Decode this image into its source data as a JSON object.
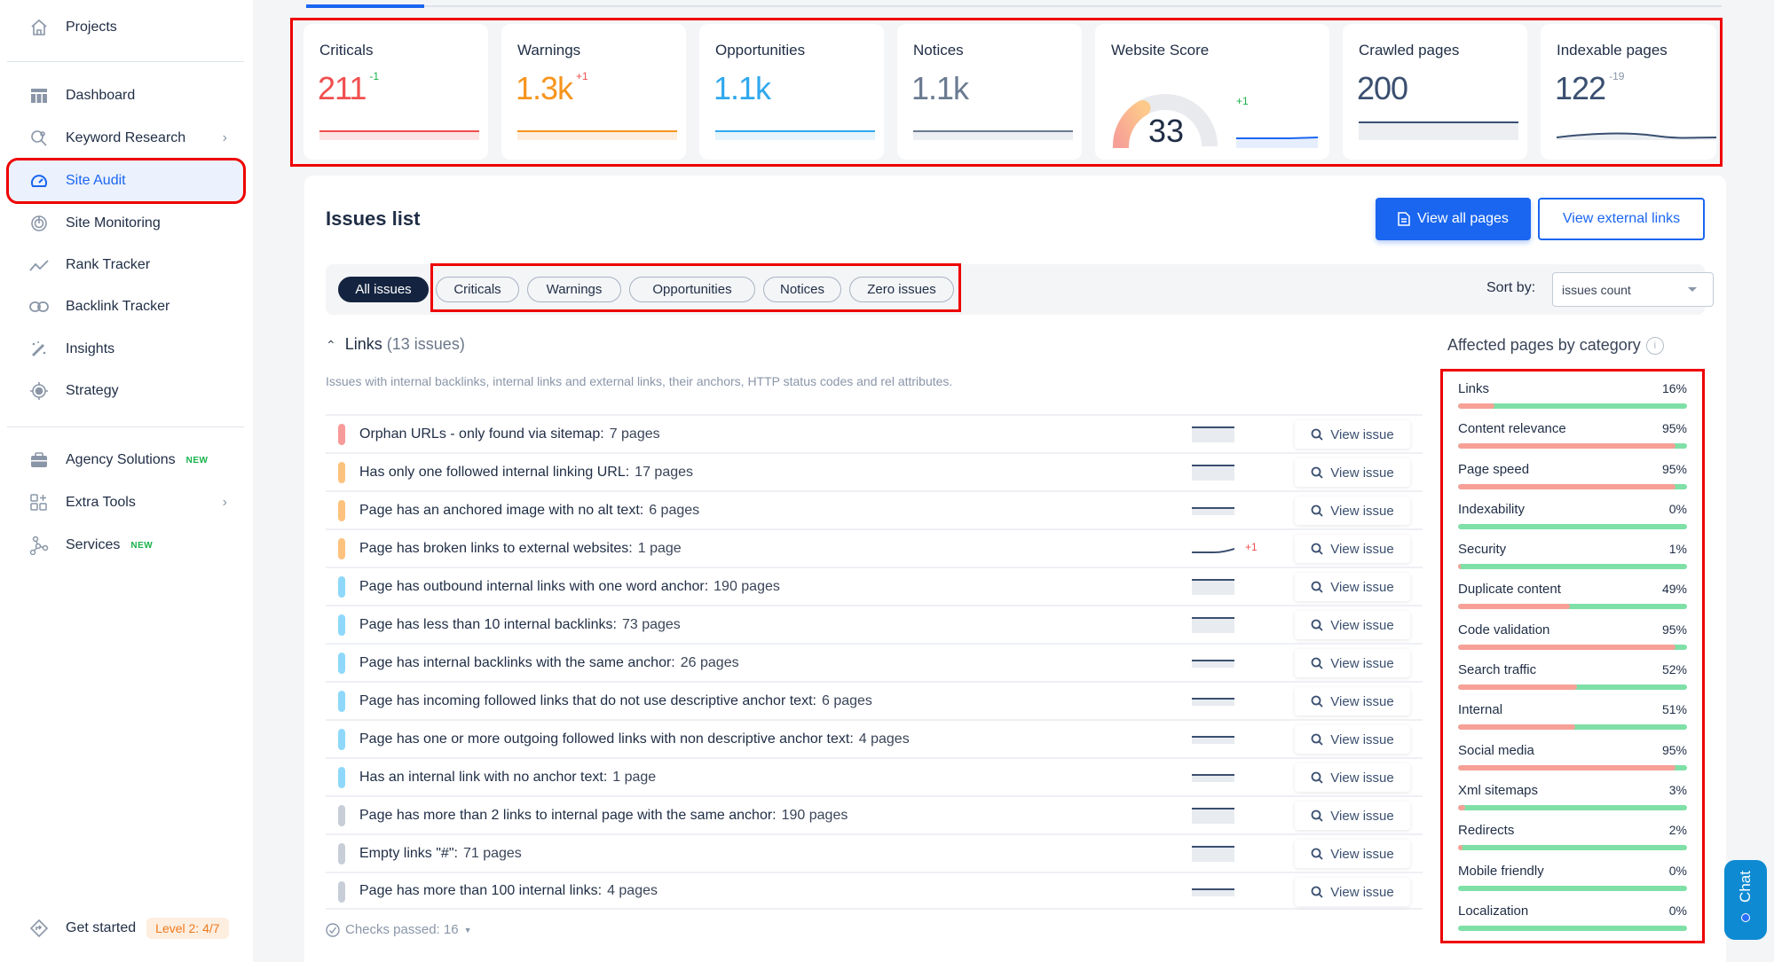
{
  "sidebar": {
    "items": [
      {
        "label": "Projects",
        "icon": "home-icon"
      },
      {
        "label": "Dashboard",
        "icon": "dashboard-icon"
      },
      {
        "label": "Keyword Research",
        "icon": "keyword-research-icon",
        "chevron": true
      },
      {
        "label": "Site Audit",
        "icon": "gauge-icon",
        "active": true
      },
      {
        "label": "Site Monitoring",
        "icon": "monitoring-icon"
      },
      {
        "label": "Rank Tracker",
        "icon": "trend-icon"
      },
      {
        "label": "Backlink Tracker",
        "icon": "link-icon"
      },
      {
        "label": "Insights",
        "icon": "magic-wand-icon"
      },
      {
        "label": "Strategy",
        "icon": "target-icon"
      },
      {
        "label": "Agency Solutions",
        "icon": "briefcase-icon",
        "badge": "NEW"
      },
      {
        "label": "Extra Tools",
        "icon": "grid-plus-icon",
        "chevron": true
      },
      {
        "label": "Services",
        "icon": "nodes-icon",
        "badge": "NEW"
      }
    ],
    "get_started": {
      "label": "Get started",
      "level": "Level 2: 4/7"
    }
  },
  "cards": [
    {
      "title": "Criticals",
      "value": "211",
      "delta": "-1",
      "color": "#f04f4f",
      "delta_color": "#17b24a"
    },
    {
      "title": "Warnings",
      "value": "1.3k",
      "delta": "+1",
      "color": "#f7941d",
      "delta_color": "#f04f4f"
    },
    {
      "title": "Opportunities",
      "value": "1.1k",
      "delta": "",
      "color": "#2fa8ee"
    },
    {
      "title": "Notices",
      "value": "1.1k",
      "delta": "",
      "color": "#6b7a90"
    },
    {
      "title": "Website Score",
      "value": "33",
      "delta": "+1",
      "score_percent": 33,
      "delta_color": "#17b24a"
    },
    {
      "title": "Crawled pages",
      "value": "200",
      "delta": "",
      "color": "#3a4f70"
    },
    {
      "title": "Indexable pages",
      "value": "122",
      "delta": "-19",
      "color": "#3a4f70",
      "delta_color": "#8a96a8"
    }
  ],
  "issues": {
    "title": "Issues list",
    "view_all_pages": "View all pages",
    "view_external_links": "View external links",
    "filters": [
      "All issues",
      "Criticals",
      "Warnings",
      "Opportunities",
      "Notices",
      "Zero issues"
    ],
    "active_filter": "All issues",
    "sort_label": "Sort by:",
    "sort_value": "issues count",
    "group": {
      "name": "Links",
      "count": "(13 issues)",
      "description": "Issues with internal backlinks, internal links and external links, their anchors, HTTP status codes and rel attributes."
    },
    "view_issue_label": "View issue",
    "rows": [
      {
        "text": "Orphan URLs - only found via sitemap:",
        "pages": "7 pages",
        "severity": "critical",
        "delta": ""
      },
      {
        "text": "Has only one followed internal linking URL:",
        "pages": "17 pages",
        "severity": "warning",
        "delta": ""
      },
      {
        "text": "Page has an anchored image with no alt text:",
        "pages": "6 pages",
        "severity": "warning",
        "delta": ""
      },
      {
        "text": "Page has broken links to external websites:",
        "pages": "1 page",
        "severity": "warning",
        "delta": "+1"
      },
      {
        "text": "Page has outbound internal links with one word anchor:",
        "pages": "190 pages",
        "severity": "opportunity",
        "delta": ""
      },
      {
        "text": "Page has less than 10 internal backlinks:",
        "pages": "73 pages",
        "severity": "opportunity",
        "delta": ""
      },
      {
        "text": "Page has internal backlinks with the same anchor:",
        "pages": "26 pages",
        "severity": "opportunity",
        "delta": ""
      },
      {
        "text": "Page has incoming followed links that do not use descriptive anchor text:",
        "pages": "6 pages",
        "severity": "opportunity",
        "delta": ""
      },
      {
        "text": "Page has one or more outgoing followed links with non descriptive anchor text:",
        "pages": "4 pages",
        "severity": "opportunity",
        "delta": ""
      },
      {
        "text": "Has an internal link with no anchor text:",
        "pages": "1 page",
        "severity": "opportunity",
        "delta": ""
      },
      {
        "text": "Page has more than 2 links to internal page with the same anchor:",
        "pages": "190 pages",
        "severity": "notice",
        "delta": ""
      },
      {
        "text": "Empty links \"#\":",
        "pages": "71 pages",
        "severity": "notice",
        "delta": ""
      },
      {
        "text": "Page has more than 100 internal links:",
        "pages": "4 pages",
        "severity": "notice",
        "delta": ""
      }
    ],
    "checks_passed": "Checks passed: 16"
  },
  "severity_colors": {
    "critical": "#f79a9a",
    "warning": "#fdc27e",
    "opportunity": "#8fd8fb",
    "notice": "#c8ced8"
  },
  "affected": {
    "title": "Affected pages by category",
    "categories": [
      {
        "name": "Links",
        "percent": 16
      },
      {
        "name": "Content relevance",
        "percent": 95
      },
      {
        "name": "Page speed",
        "percent": 95
      },
      {
        "name": "Indexability",
        "percent": 0
      },
      {
        "name": "Security",
        "percent": 1
      },
      {
        "name": "Duplicate content",
        "percent": 49
      },
      {
        "name": "Code validation",
        "percent": 95
      },
      {
        "name": "Search traffic",
        "percent": 52
      },
      {
        "name": "Internal",
        "percent": 51
      },
      {
        "name": "Social media",
        "percent": 95
      },
      {
        "name": "Xml sitemaps",
        "percent": 3
      },
      {
        "name": "Redirects",
        "percent": 2
      },
      {
        "name": "Mobile friendly",
        "percent": 0
      },
      {
        "name": "Localization",
        "percent": 0
      }
    ]
  },
  "chat": {
    "label": "Chat"
  }
}
